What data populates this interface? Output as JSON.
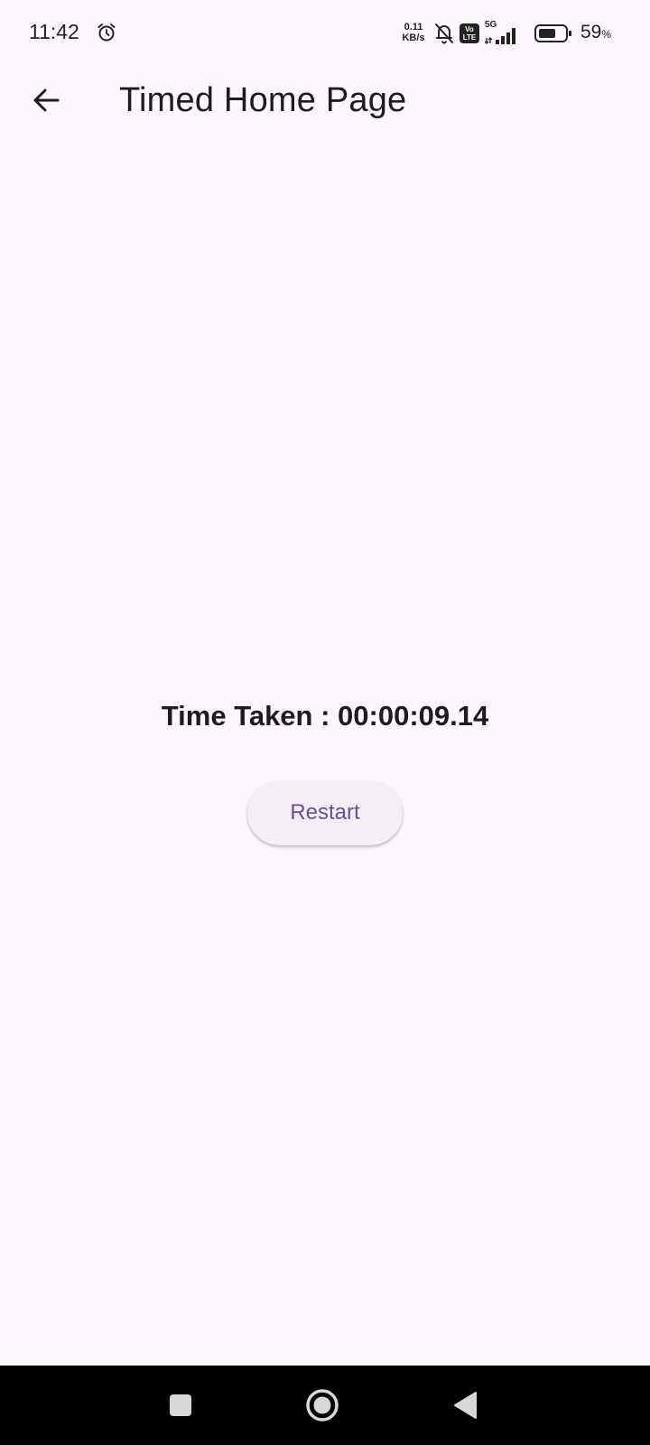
{
  "status_bar": {
    "time": "11:42",
    "net_speed_value": "0.11",
    "net_speed_unit": "KB/s",
    "volte_top": "Vo",
    "volte_bottom": "LTE",
    "network_type": "5G",
    "battery_percent": "59",
    "battery_unit": "%",
    "icons": [
      "alarm-icon",
      "bell-off-icon",
      "volte-icon",
      "signal-icon",
      "battery-icon"
    ]
  },
  "app_bar": {
    "title": "Timed Home Page",
    "back_icon": "arrow-left-icon"
  },
  "main": {
    "time_taken": "Time Taken : 00:00:09.14",
    "restart_label": "Restart"
  },
  "nav_bar": {
    "icons": [
      "recent-apps-icon",
      "home-icon",
      "back-nav-icon"
    ]
  },
  "colors": {
    "background": "#fcf7fd",
    "button_background": "#f4eff6",
    "button_text": "#66519e",
    "text": "#1d1b20",
    "nav_bar": "#000000"
  }
}
